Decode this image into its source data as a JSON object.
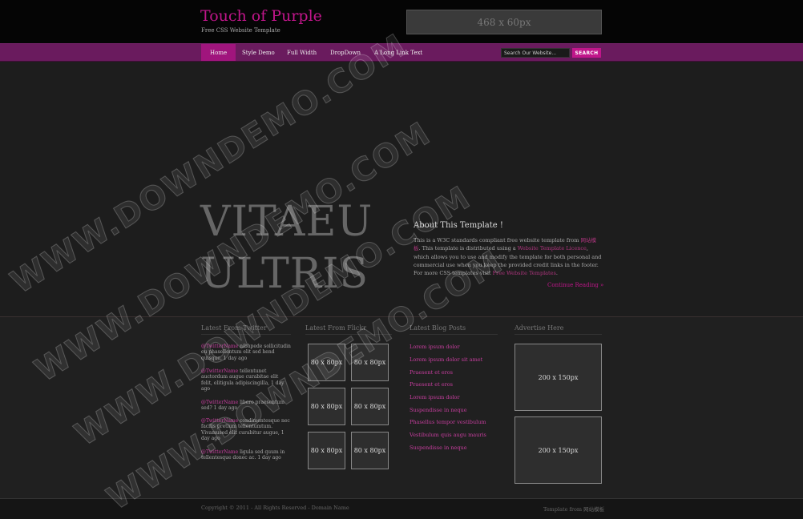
{
  "header": {
    "site_title": "Touch of Purple",
    "tagline": "Free CSS Website Template",
    "banner_ad": "468 x 60px"
  },
  "nav": {
    "items": [
      {
        "label": "Home",
        "active": true
      },
      {
        "label": "Style Demo"
      },
      {
        "label": "Full Width"
      },
      {
        "label": "DropDown"
      },
      {
        "label": "A Long Link Text"
      }
    ],
    "search_placeholder": "Search Our Website...",
    "search_button": "SEARCH"
  },
  "hero": {
    "line1": "VITAEU",
    "line2": "ULTRIS"
  },
  "about": {
    "title": "About This Template !",
    "text_1": "This is a W3C standards compliant free website template from ",
    "link_1": "网站模板",
    "text_2": ". This template is distributed using a ",
    "link_2": "Website Template Licence",
    "text_3": ", which allows you to use and modify the template for both personal and commercial use when you keep the provided credit links in the footer. For more CSS templates visit ",
    "link_3": "Free Website Templates",
    "text_4": ".",
    "continue": "Continue Reading »"
  },
  "twitter": {
    "title": "Latest From Twitter",
    "tweets": [
      {
        "handle": "@TwitterName",
        "text": " nibhpede sollicitudin eu phasellentum elit sed hend quisque,",
        "time": "1 day ago"
      },
      {
        "handle": "@TwitterName",
        "text": " tellentunet auctordum augue curabitae elit felit, elitigula adipiscingilla,",
        "time": "1 day ago"
      },
      {
        "handle": "@TwitterName",
        "text": " libero praesentum sed?",
        "time": "1 day ago"
      },
      {
        "handle": "@TwitterName",
        "text": " condimentesque nec facilis pretium tellentumtum. Vivamused elit curabitur augue,",
        "time": "1 day ago"
      },
      {
        "handle": "@TwitterName",
        "text": " ligula sed quum in tellentesque donec ac.",
        "time": "1 day ago"
      }
    ]
  },
  "flickr": {
    "title": "Latest From Flickr",
    "thumbs": [
      "80 x 80px",
      "80 x 80px",
      "80 x 80px",
      "80 x 80px",
      "80 x 80px",
      "80 x 80px"
    ]
  },
  "blog": {
    "title": "Latest Blog Posts",
    "posts": [
      "Lorem ipsum dolor",
      "Lorem ipsum dolor sit amet",
      "Praesent et eros",
      "Praesent et eros",
      "Lorem ipsum dolor",
      "Suspendisse in neque",
      "Phasellus tempor vestibulum",
      "Vestibulum quis augu mauris",
      "Suspendisse in neque"
    ]
  },
  "advertise": {
    "title": "Advertise Here",
    "boxes": [
      "200 x 150px",
      "200 x 150px"
    ]
  },
  "footer": {
    "copyright": "Copyright © 2011 - All Rights Reserved - Domain Name",
    "credit": "Template from 网站模板"
  },
  "watermark": {
    "text": "WWW.DOWNDEMO.COM"
  }
}
